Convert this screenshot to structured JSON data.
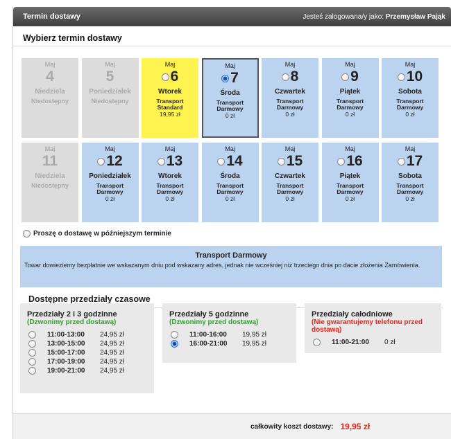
{
  "header": {
    "title": "Termin dostawy",
    "login_prefix": "Jesteś zalogowana/y jako:",
    "user": "Przemysław Pająk"
  },
  "section_title": "Wybierz termin dostawy",
  "days": [
    {
      "month": "Maj",
      "day": "4",
      "name": "Niedziela",
      "state": "unavailable",
      "status": "Niedostępny"
    },
    {
      "month": "Maj",
      "day": "5",
      "name": "Poniedziałek",
      "state": "unavailable",
      "status": "Niedostępny"
    },
    {
      "month": "Maj",
      "day": "6",
      "name": "Wtorek",
      "state": "standard",
      "line1": "Transport",
      "line2": "Standard",
      "price": "19,95 zł"
    },
    {
      "month": "Maj",
      "day": "7",
      "name": "Środa",
      "state": "selected",
      "line1": "Transport",
      "line2": "Darmowy",
      "price": "0 zł"
    },
    {
      "month": "Maj",
      "day": "8",
      "name": "Czwartek",
      "state": "free",
      "line1": "Transport",
      "line2": "Darmowy",
      "price": "0 zł"
    },
    {
      "month": "Maj",
      "day": "9",
      "name": "Piątek",
      "state": "free",
      "line1": "Transport",
      "line2": "Darmowy",
      "price": "0 zł"
    },
    {
      "month": "Maj",
      "day": "10",
      "name": "Sobota",
      "state": "free",
      "line1": "Transport",
      "line2": "Darmowy",
      "price": "0 zł"
    },
    {
      "month": "Maj",
      "day": "11",
      "name": "Niedziela",
      "state": "unavailable",
      "status": "Niedostępny"
    },
    {
      "month": "Maj",
      "day": "12",
      "name": "Poniedziałek",
      "state": "free",
      "line1": "Transport",
      "line2": "Darmowy",
      "price": "0 zł"
    },
    {
      "month": "Maj",
      "day": "13",
      "name": "Wtorek",
      "state": "free",
      "line1": "Transport",
      "line2": "Darmowy",
      "price": "0 zł"
    },
    {
      "month": "Maj",
      "day": "14",
      "name": "Środa",
      "state": "free",
      "line1": "Transport",
      "line2": "Darmowy",
      "price": "0 zł"
    },
    {
      "month": "Maj",
      "day": "15",
      "name": "Czwartek",
      "state": "free",
      "line1": "Transport",
      "line2": "Darmowy",
      "price": "0 zł"
    },
    {
      "month": "Maj",
      "day": "16",
      "name": "Piątek",
      "state": "free",
      "line1": "Transport",
      "line2": "Darmowy",
      "price": "0 zł"
    },
    {
      "month": "Maj",
      "day": "17",
      "name": "Sobota",
      "state": "free",
      "line1": "Transport",
      "line2": "Darmowy",
      "price": "0 zł"
    }
  ],
  "later_option": "Proszę o dostawę w późniejszym terminie",
  "info": {
    "title": "Transport Darmowy",
    "text": "Towar dowieziemy bezpłatnie we wskazanym dniu pod wskazany adres, jednak nie wcześniej niż trzeciego dnia po dacie złożenia Zamówienia."
  },
  "slots_title": "Dostępne przedziały czasowe",
  "slot_groups": [
    {
      "title": "Przedziały 2 i 3 godzinne",
      "note": "(Dzwonimy przed dostawą)",
      "note_color": "green",
      "options": [
        {
          "time": "11:00-13:00",
          "price": "24,95 zł",
          "selected": false
        },
        {
          "time": "13:00-15:00",
          "price": "24,95 zł",
          "selected": false
        },
        {
          "time": "15:00-17:00",
          "price": "24,95 zł",
          "selected": false
        },
        {
          "time": "17:00-19:00",
          "price": "24,95 zł",
          "selected": false
        },
        {
          "time": "19:00-21:00",
          "price": "24,95 zł",
          "selected": false
        }
      ]
    },
    {
      "title": "Przedziały 5 godzinne",
      "note": "(Dzwonimy przed dostawą)",
      "note_color": "green",
      "options": [
        {
          "time": "11:00-16:00",
          "price": "19,95 zł",
          "selected": false
        },
        {
          "time": "16:00-21:00",
          "price": "19,95 zł",
          "selected": true
        }
      ]
    },
    {
      "title": "Przedziały całodniowe",
      "note": "(Nie gwarantujemy telefonu przed dostawą)",
      "note_color": "red",
      "options": [
        {
          "time": "11:00-21:00",
          "price": "0 zł",
          "selected": false
        }
      ]
    }
  ],
  "footer": {
    "label": "całkowity koszt dostawy:",
    "value": "19,95 zł"
  },
  "colors": {
    "free": "#bcd3f0",
    "standard": "#fff44f",
    "unavailable": "#dcdcdc",
    "total": "#e0261d",
    "green_note": "#2aa52a"
  }
}
